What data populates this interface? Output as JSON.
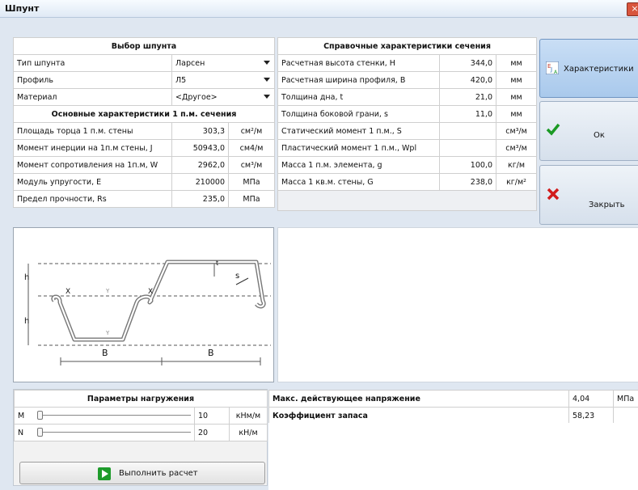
{
  "window": {
    "title": "Шпунт",
    "close_icon": "close-icon"
  },
  "selection": {
    "header": "Выбор шпунта",
    "rows": [
      {
        "label": "Тип шпунта",
        "value": "Ларсен"
      },
      {
        "label": "Профиль",
        "value": "Л5"
      },
      {
        "label": "Материал",
        "value": "<Другое>"
      }
    ]
  },
  "main_section": {
    "header": "Основные характеристики 1 п.м. сечения",
    "rows": [
      {
        "label": "Площадь торца 1 п.м. стены",
        "value": "303,3",
        "unit": "см²/м"
      },
      {
        "label": "Момент инерции на 1п.м стены, J",
        "value": "50943,0",
        "unit": "см4/м"
      },
      {
        "label": "Момент сопротивления на 1п.м, W",
        "value": "2962,0",
        "unit": "см³/м"
      },
      {
        "label": "Модуль упругости, E",
        "value": "210000",
        "unit": "МПа"
      },
      {
        "label": "Предел прочности, Rs",
        "value": "235,0",
        "unit": "МПа"
      }
    ]
  },
  "reference": {
    "header": "Справочные характеристики сечения",
    "rows": [
      {
        "label": "Расчетная высота стенки, H",
        "value": "344,0",
        "unit": "мм"
      },
      {
        "label": "Расчетная ширина профиля, B",
        "value": "420,0",
        "unit": "мм"
      },
      {
        "label": "Толщина дна, t",
        "value": "21,0",
        "unit": "мм"
      },
      {
        "label": "Толщина боковой грани, s",
        "value": "11,0",
        "unit": "мм"
      },
      {
        "label": "Статический момент 1 п.м., S",
        "value": "",
        "unit": "см³/м"
      },
      {
        "label": "Пластический момент 1 п.м., Wpl",
        "value": "",
        "unit": "см³/м"
      },
      {
        "label": "Масса 1 п.м. элемента, g",
        "value": "100,0",
        "unit": "кг/м"
      },
      {
        "label": "Масса 1 кв.м. стены, G",
        "value": "238,0",
        "unit": "кг/м²"
      }
    ]
  },
  "buttons": {
    "characteristics": "Характеристики",
    "ok": "Ок",
    "close": "Закрыть",
    "run": "Выполнить расчет"
  },
  "figure": {
    "labels": {
      "h": "h",
      "b": "B",
      "x": "X",
      "y": "Y",
      "s": "s",
      "t": "t"
    }
  },
  "loading": {
    "header": "Параметры нагружения",
    "rows": [
      {
        "label": "M",
        "value": "10",
        "unit": "кНм/м"
      },
      {
        "label": "N",
        "value": "20",
        "unit": "кН/м"
      }
    ]
  },
  "results": {
    "rows": [
      {
        "label": "Макс. действующее напряжение",
        "value": "4,04",
        "unit": "МПа"
      },
      {
        "label": "Коэффициент запаса",
        "value": "58,23",
        "unit": ""
      }
    ]
  },
  "colors": {
    "accent": "#a9c9ec",
    "ok_check": "#1b9a24",
    "close_x": "#d11c1c"
  }
}
